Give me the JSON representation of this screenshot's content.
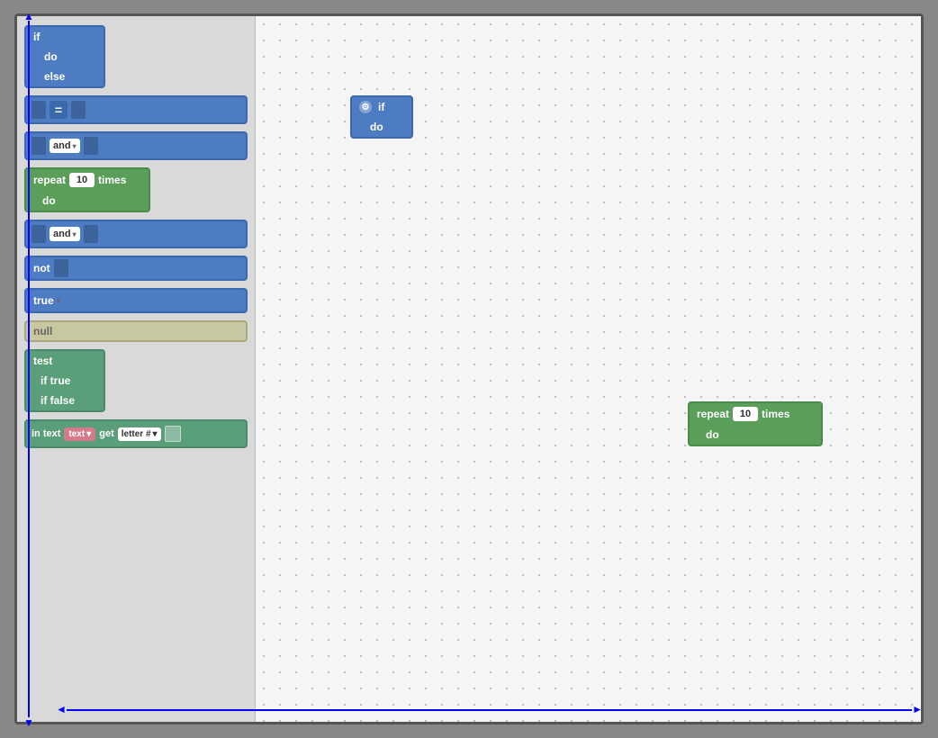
{
  "sidebar": {
    "blocks": {
      "if_block": {
        "if_label": "if",
        "do_label": "do",
        "else_label": "else"
      },
      "equals_block": {
        "symbol": "="
      },
      "and_block1": {
        "label": "and",
        "dropdown_arrow": "▾"
      },
      "repeat_block": {
        "repeat_label": "repeat",
        "times_label": "times",
        "do_label": "do",
        "value": "10"
      },
      "and_block2": {
        "label": "and",
        "dropdown_arrow": "▾"
      },
      "not_block": {
        "label": "not"
      },
      "true_block": {
        "label": "true",
        "dropdown_arrow": "▾"
      },
      "null_block": {
        "label": "null"
      },
      "test_block": {
        "test_label": "test",
        "if_true_label": "if true",
        "if_false_label": "if false"
      },
      "intext_block": {
        "in_label": "in text",
        "text_label": "text",
        "get_label": "get",
        "letter_label": "letter #",
        "dropdown_arrow": "▾"
      }
    }
  },
  "canvas": {
    "if_block": {
      "if_label": "if",
      "do_label": "do",
      "gear": "⚙"
    },
    "repeat_block": {
      "repeat_label": "repeat",
      "times_label": "times",
      "do_label": "do",
      "value": "10"
    }
  }
}
